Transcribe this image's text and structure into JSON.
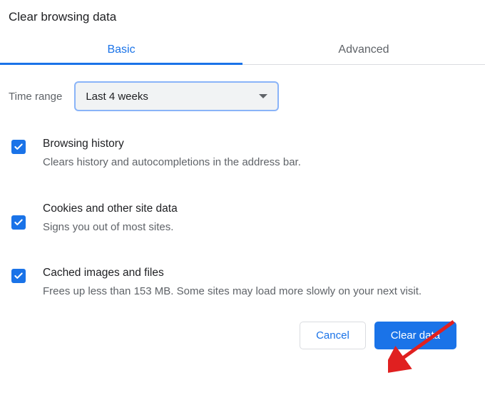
{
  "title": "Clear browsing data",
  "tabs": {
    "basic": "Basic",
    "advanced": "Advanced"
  },
  "time_range": {
    "label": "Time range",
    "selected": "Last 4 weeks"
  },
  "options": [
    {
      "title": "Browsing history",
      "desc": "Clears history and autocompletions in the address bar.",
      "checked": true
    },
    {
      "title": "Cookies and other site data",
      "desc": "Signs you out of most sites.",
      "checked": true
    },
    {
      "title": "Cached images and files",
      "desc": "Frees up less than 153 MB. Some sites may load more slowly on your next visit.",
      "checked": true
    }
  ],
  "buttons": {
    "cancel": "Cancel",
    "clear": "Clear data"
  }
}
